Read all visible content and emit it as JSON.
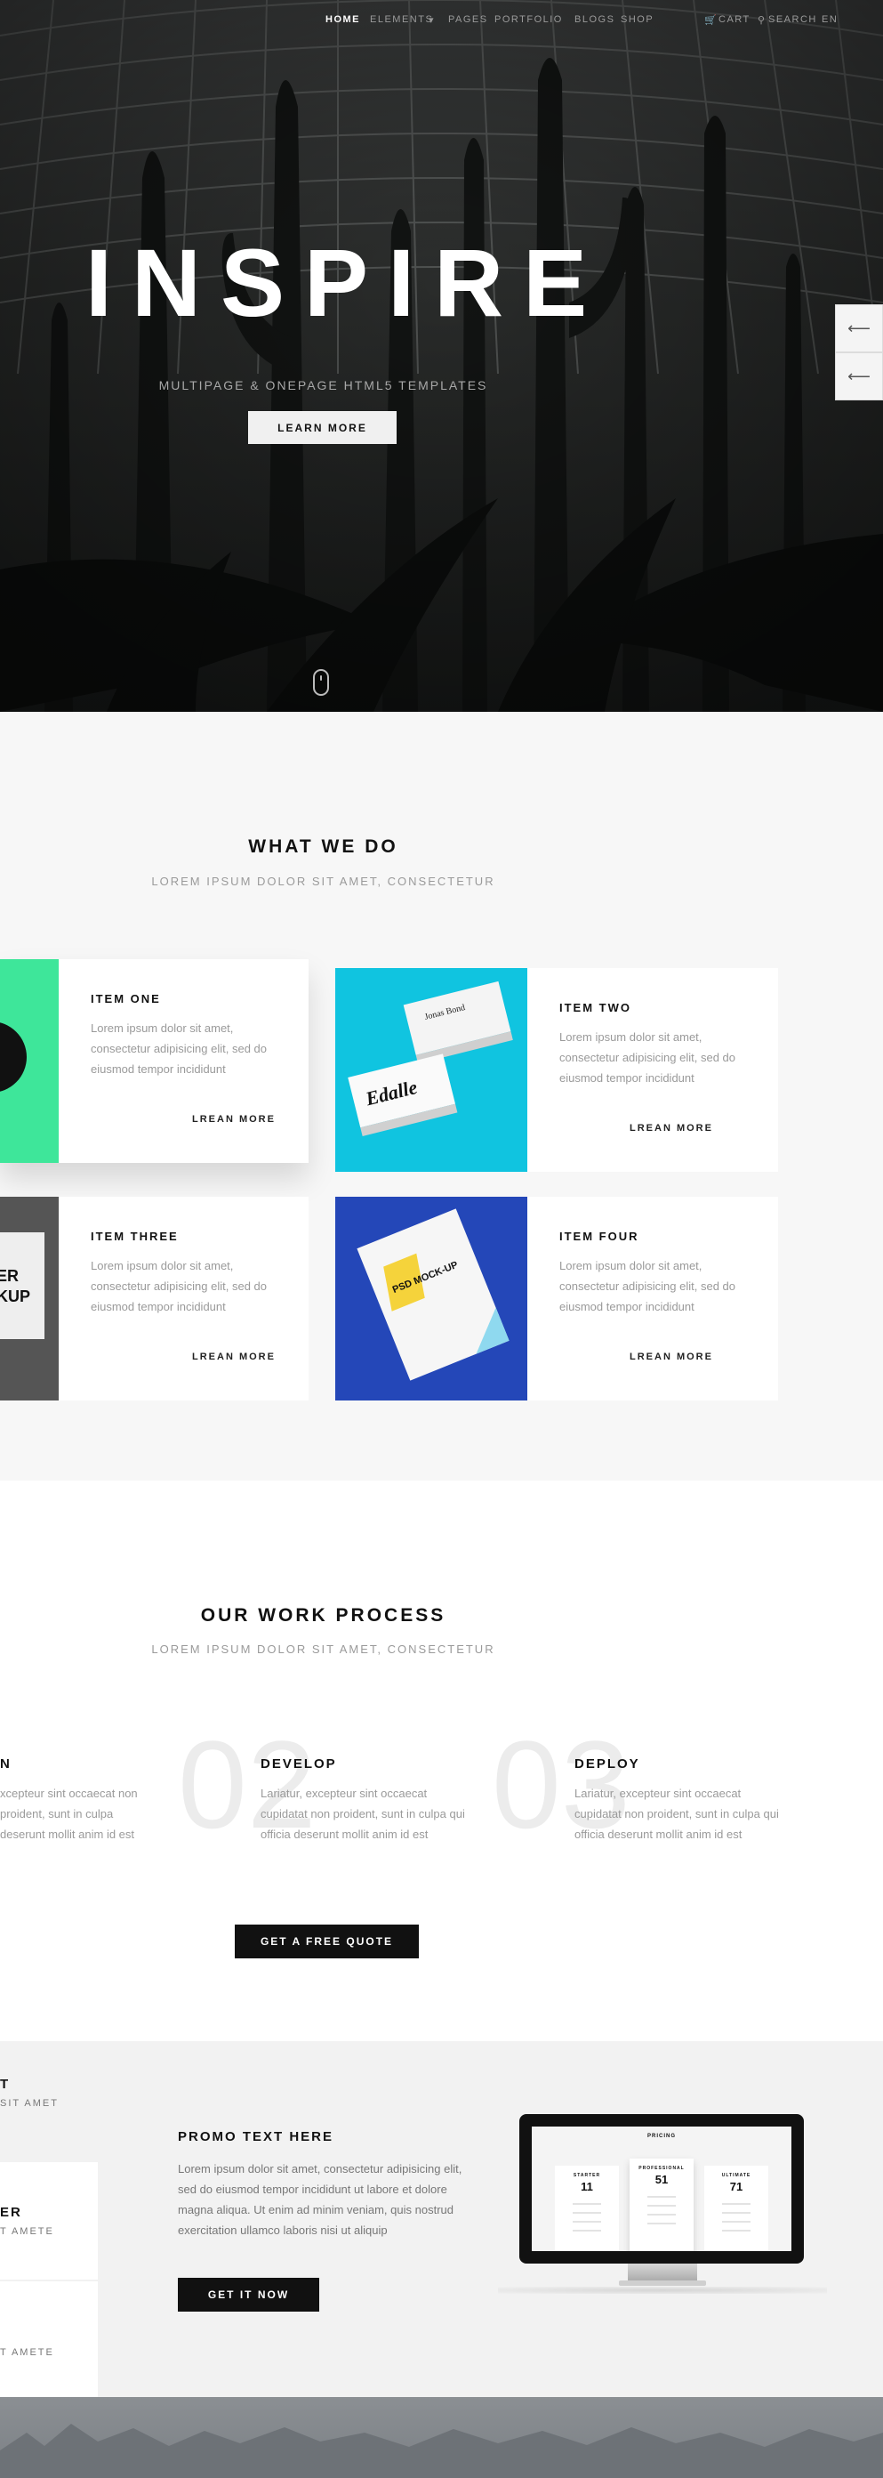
{
  "nav": {
    "items": [
      "HOME",
      "ELEMENTS",
      "PAGES",
      "PORTFOLIO",
      "BLOGS",
      "SHOP",
      "CART",
      "SEARCH",
      "EN"
    ],
    "active": "HOME"
  },
  "hero": {
    "title": "INSPIRE",
    "subtitle": "MULTIPAGE & ONEPAGE HTML5 TEMPLATES",
    "button": "LEARN MORE",
    "arrow_prev": "⟵",
    "arrow_next": "⟵"
  },
  "services": {
    "title": "WHAT WE DO",
    "subtitle": "LOREM IPSUM DOLOR SIT AMET, CONSECTETUR",
    "items": [
      {
        "title": "ITEM ONE",
        "text": "Lorem ipsum dolor sit amet, consectetur adipisicing elit, sed do eiusmod tempor incididunt",
        "link": "LREAN MORE"
      },
      {
        "title": "ITEM TWO",
        "text": "Lorem ipsum dolor sit amet, consectetur adipisicing elit, sed do eiusmod tempor incididunt",
        "link": "LREAN MORE"
      },
      {
        "title": "ITEM THREE",
        "text": "Lorem ipsum dolor sit amet, consectetur adipisicing elit, sed do eiusmod tempor incididunt",
        "link": "LREAN MORE"
      },
      {
        "title": "ITEM FOUR",
        "text": "Lorem ipsum dolor sit amet, consectetur adipisicing elit, sed do eiusmod tempor incididunt",
        "link": "LREAN MORE"
      }
    ],
    "card_images": {
      "item_two_card_name": "Jonas Bond",
      "item_two_logo": "Edalle",
      "item_four_badge": "PSD MOCK-UP"
    }
  },
  "process": {
    "title": "OUR WORK PROCESS",
    "subtitle": "LOREM IPSUM DOLOR SIT AMET, CONSECTETUR",
    "steps": [
      {
        "num": "",
        "title": "N",
        "text": "xcepteur sint occaecat non proident, sunt in culpa deserunt mollit anim id est"
      },
      {
        "num": "02",
        "title": "DEVELOP",
        "text": "Lariatur, excepteur sint occaecat cupidatat non proident, sunt in culpa qui officia deserunt mollit anim id est"
      },
      {
        "num": "03",
        "title": "DEPLOY",
        "text": "Lariatur, excepteur sint occaecat cupidatat non proident, sunt in culpa qui officia deserunt mollit anim id est"
      }
    ],
    "button": "GET A FREE QUOTE"
  },
  "promo": {
    "left_fragments": [
      "T",
      "SIT AMET",
      "ER",
      "T AMETE",
      "T AMETE"
    ],
    "title": "PROMO TEXT HERE",
    "text": "Lorem ipsum dolor sit amet, consectetur adipisicing elit, sed do eiusmod tempor incididunt ut labore et dolore magna aliqua. Ut enim ad minim veniam, quis nostrud exercitation ullamco laboris nisi ut aliquip",
    "button": "GET IT NOW",
    "screen": {
      "title": "PRICING",
      "plans": [
        {
          "name": "STARTER",
          "price": "11"
        },
        {
          "name": "PROFESSIONAL",
          "price": "51"
        },
        {
          "name": "ULTIMATE",
          "price": "71"
        }
      ]
    }
  },
  "colors": {
    "accent_green": "#3ee69a",
    "accent_cyan": "#10c4e0",
    "accent_blue": "#2447b8",
    "button_dark": "#111111"
  }
}
